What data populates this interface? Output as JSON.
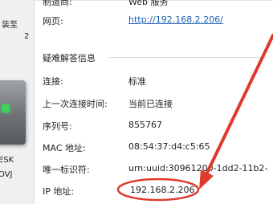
{
  "sidebar": {
    "fragments": [
      "装至",
      "2",
      "ESK",
      "OVJ"
    ]
  },
  "device": {
    "icon": "network-device-icon",
    "led_color": "#3cd35a"
  },
  "header": {
    "rows": [
      {
        "label": "制造商:",
        "value": "Web 服务"
      },
      {
        "label": "网页:",
        "value": "http://192.168.2.206/"
      }
    ]
  },
  "troubleshooting": {
    "title": "疑难解答信息",
    "rows": [
      {
        "label": "连接:",
        "value": "标准"
      },
      {
        "label": "上一次连接时间:",
        "value": "当前已连接"
      },
      {
        "label": "序列号:",
        "value": "855767"
      },
      {
        "label": "MAC 地址:",
        "value": "08:54:37:d4:c5:65"
      },
      {
        "label": "唯一标识符:",
        "value": "urn:uuid:30961200-1dd2-11b2-"
      },
      {
        "label": "IP 地址:",
        "value": "192.168.2.206"
      }
    ]
  },
  "annotation": {
    "color": "#e03a2f",
    "arrow_icon": "red-arrow-icon",
    "circle_icon": "red-circle-icon"
  }
}
